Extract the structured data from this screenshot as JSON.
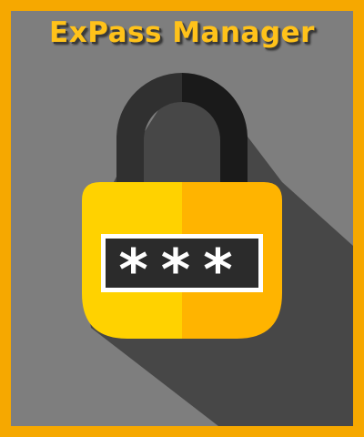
{
  "app": {
    "title": "ExPass Manager"
  },
  "graphic": {
    "icon": "padlock-icon",
    "masked_password": "***"
  },
  "colors": {
    "frame": "#f6a800",
    "background": "#7e7e7e",
    "shadow": "#444444",
    "title": "#ffc21a",
    "lock_body_left": "#ffd200",
    "lock_body_right": "#ffb400",
    "shackle_left": "#303030",
    "shackle_right": "#1a1a1a",
    "field_bg": "#2b2b2b",
    "field_border": "#ffffff",
    "mask_char": "#ffffff"
  }
}
